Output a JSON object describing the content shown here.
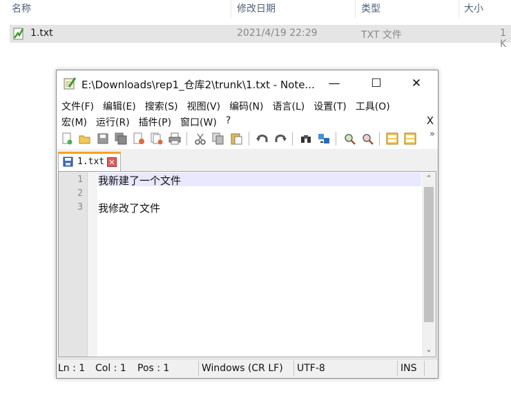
{
  "explorer": {
    "columns": {
      "name": "名称",
      "modified": "修改日期",
      "type": "类型",
      "size": "大小"
    },
    "file": {
      "name": "1.txt",
      "modified": "2021/4/19 22:29",
      "type": "TXT 文件",
      "size": "1 K"
    }
  },
  "window": {
    "title": "E:\\Downloads\\rep1_仓库2\\trunk\\1.txt - Note...",
    "controls": {
      "minimize": "—",
      "maximize": "☐",
      "close": "✕"
    }
  },
  "menu": {
    "row1": [
      "文件(F)",
      "编辑(E)",
      "搜索(S)",
      "视图(V)",
      "编码(N)",
      "语言(L)",
      "设置(T)",
      "工具(O)"
    ],
    "row2": [
      "宏(M)",
      "运行(R)",
      "插件(P)",
      "窗口(W)",
      "?"
    ],
    "close_doc": "X"
  },
  "toolbar": {
    "more": "»",
    "icons": [
      "new-file",
      "open-file",
      "save",
      "save-all",
      "close",
      "close-all",
      "print",
      "cut",
      "copy",
      "paste",
      "undo",
      "redo",
      "find",
      "replace",
      "zoom-in",
      "zoom-out",
      "sync-v",
      "sync-h"
    ]
  },
  "tab": {
    "label": "1.txt",
    "close": "✕"
  },
  "editor": {
    "lines": [
      {
        "num": "1",
        "text": "我新建了一个文件"
      },
      {
        "num": "2",
        "text": ""
      },
      {
        "num": "3",
        "text": "我修改了文件"
      }
    ],
    "scroll_up": "⌃",
    "scroll_down": "⌄"
  },
  "status": {
    "ln": "Ln : 1",
    "col": "Col : 1",
    "pos": "Pos : 1",
    "eol": "Windows (CR LF)",
    "encoding": "UTF-8",
    "mode": "INS"
  },
  "colors": {
    "tab_accent": "#f6a21e",
    "current_line": "#e8e8ff",
    "selected_row": "#e5e5e5"
  }
}
